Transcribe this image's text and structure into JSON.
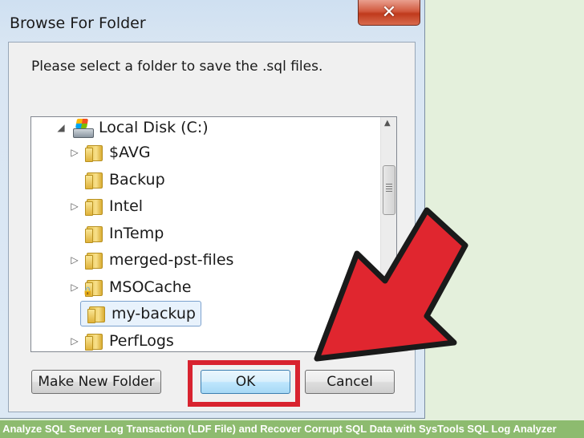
{
  "dialog": {
    "title": "Browse For Folder",
    "close_label": "✕",
    "prompt": "Please select a folder to save the .sql files.",
    "tree": {
      "root": "Local Disk (C:)",
      "items": [
        {
          "label": "$AVG",
          "expander": "▷"
        },
        {
          "label": "Backup",
          "expander": ""
        },
        {
          "label": "Intel",
          "expander": "▷"
        },
        {
          "label": "InTemp",
          "expander": ""
        },
        {
          "label": "merged-pst-files",
          "expander": "▷"
        },
        {
          "label": "MSOCache",
          "expander": "▷"
        },
        {
          "label": "my-backup",
          "expander": ""
        },
        {
          "label": "PerfLogs",
          "expander": "▷"
        }
      ],
      "selected": "my-backup"
    },
    "buttons": {
      "make_new_folder": "Make New Folder",
      "ok": "OK",
      "cancel": "Cancel"
    }
  },
  "caption": "o Analyze SQL Server Log Transaction (LDF File) and Recover Corrupt SQL Data with SysTools SQL Log Analyzer",
  "colors": {
    "highlight": "#d8232f",
    "arrow_fill": "#e0262f",
    "caption_bg": "#8dbb6f"
  }
}
